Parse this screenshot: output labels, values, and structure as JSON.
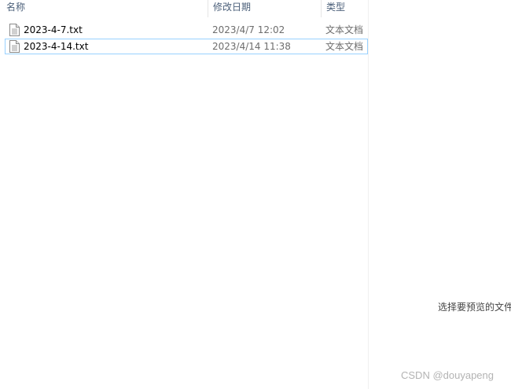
{
  "columns": {
    "name": "名称",
    "date": "修改日期",
    "type": "类型"
  },
  "files": [
    {
      "name": "2023-4-7.txt",
      "date": "2023/4/7 12:02",
      "type": "文本文档",
      "icon": "text-file-icon"
    },
    {
      "name": "2023-4-14.txt",
      "date": "2023/4/14 11:38",
      "type": "文本文档",
      "icon": "text-file-icon",
      "selected": true
    }
  ],
  "preview": {
    "message": "选择要预览的文件"
  },
  "watermark": "CSDN @douyapeng",
  "colors": {
    "selection_border": "#99d1ff",
    "header_text": "#4c607a",
    "secondary_text": "#6d6d6d"
  }
}
